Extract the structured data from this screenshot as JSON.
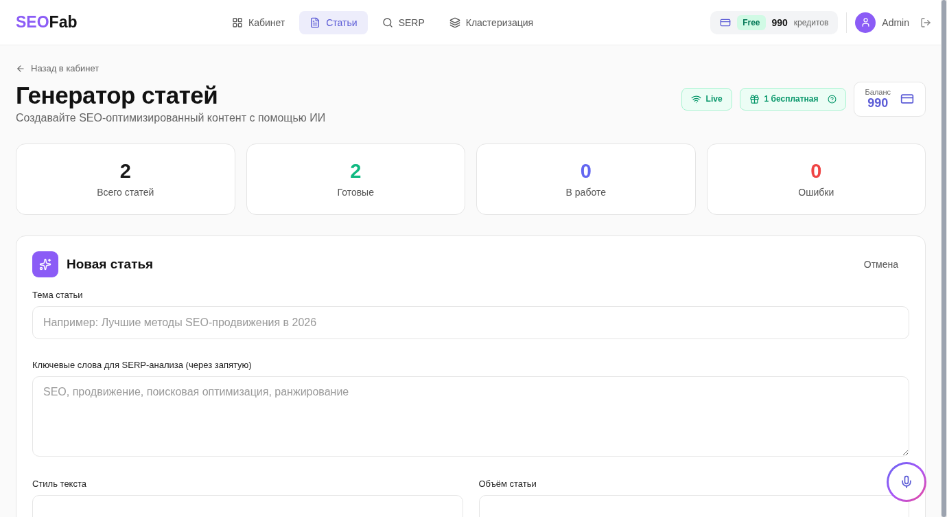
{
  "header": {
    "logo": {
      "accent": "SEO",
      "rest": "Fab"
    },
    "nav": [
      {
        "label": "Кабинет",
        "kind": "grid",
        "selected": false
      },
      {
        "label": "Статьи",
        "kind": "doc",
        "selected": true
      },
      {
        "label": "SERP",
        "kind": "search",
        "selected": false
      },
      {
        "label": "Кластеризация",
        "kind": "layers",
        "selected": false
      }
    ],
    "credits": {
      "plan": "Free",
      "amount": "990",
      "unit": "кредитов"
    },
    "user": {
      "name": "Admin"
    }
  },
  "back_link": "Назад в кабинет",
  "title": "Генератор статей",
  "subtitle": "Создавайте SEO-оптимизированный контент с помощью ИИ",
  "badges": [
    {
      "kind": "live",
      "label": "Live"
    },
    {
      "kind": "gift",
      "label": "1 бесплатная"
    }
  ],
  "balance": {
    "label": "Баланс",
    "value": "990"
  },
  "stats": [
    {
      "value": "2",
      "label": "Всего статей",
      "color": "#1a1a1a"
    },
    {
      "value": "2",
      "label": "Готовые",
      "color": "#10b981"
    },
    {
      "value": "0",
      "label": "В работе",
      "color": "#6366f1"
    },
    {
      "value": "0",
      "label": "Ошибки",
      "color": "#ef4444"
    }
  ],
  "form": {
    "title": "Новая статья",
    "cancel": "Отмена",
    "topic": {
      "label": "Тема статьи",
      "placeholder": "Например: Лучшие методы SEO-продвижения в 2026"
    },
    "keywords": {
      "label": "Ключевые слова для SERP-анализа (через запятую)",
      "placeholder": "SEO, продвижение, поисковая оптимизация, ранжирование"
    },
    "selects": [
      {
        "label": "Стиль текста"
      },
      {
        "label": "Объём статьи"
      }
    ]
  }
}
